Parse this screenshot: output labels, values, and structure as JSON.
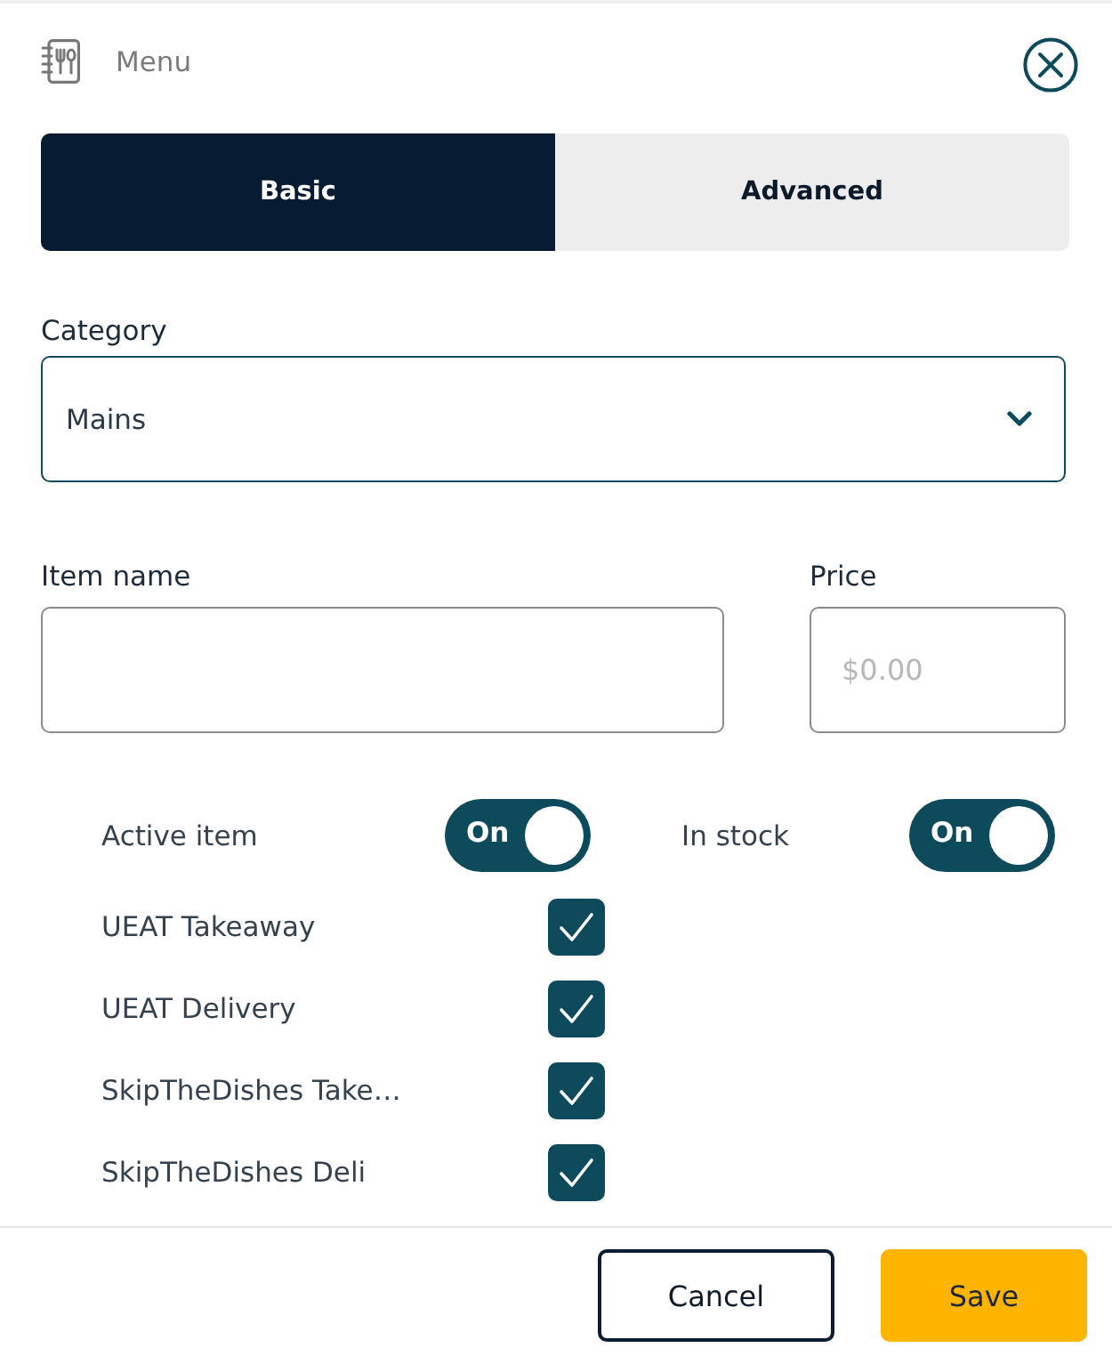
{
  "header": {
    "title": "Menu"
  },
  "tabs": [
    {
      "label": "Basic",
      "selected": true
    },
    {
      "label": "Advanced",
      "selected": false
    }
  ],
  "category": {
    "label": "Category",
    "value": "Mains"
  },
  "item_name": {
    "label": "Item name"
  },
  "price": {
    "label": "Price",
    "placeholder": "$0.00"
  },
  "toggles": [
    {
      "label": "Active item",
      "state_text": "On",
      "on": true
    },
    {
      "label": "In stock",
      "state_text": "On",
      "on": true
    }
  ],
  "channels": [
    {
      "label": "UEAT Takeaway",
      "checked": true
    },
    {
      "label": "UEAT Delivery",
      "checked": true
    },
    {
      "label": "SkipTheDishes Take…",
      "checked": true
    },
    {
      "label": "SkipTheDishes Deli",
      "checked": true
    }
  ],
  "buttons": [
    {
      "label": "Cancel",
      "kind": "secondary"
    },
    {
      "label": "Save",
      "kind": "primary"
    }
  ]
}
